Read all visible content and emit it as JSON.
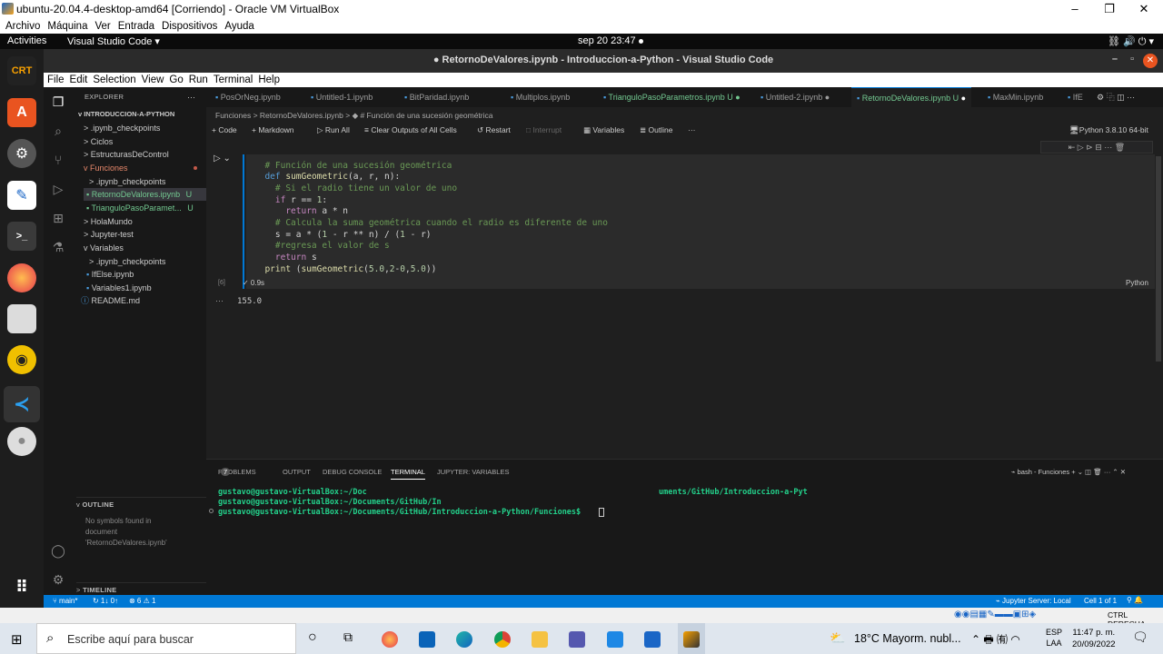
{
  "vbox": {
    "title": "ubuntu-20.04.4-desktop-amd64 [Corriendo] - Oracle VM VirtualBox",
    "menu": [
      "Archivo",
      "Máquina",
      "Ver",
      "Entrada",
      "Dispositivos",
      "Ayuda"
    ],
    "status_host_key": "CTRL DERECHA"
  },
  "ubuntu": {
    "activities": "Activities",
    "app_menu": "Visual Studio Code ▾",
    "clock": "sep 20  23:47"
  },
  "vscode": {
    "title": "● RetornoDeValores.ipynb - Introduccion-a-Python - Visual Studio Code",
    "menu": [
      "File",
      "Edit",
      "Selection",
      "View",
      "Go",
      "Run",
      "Terminal",
      "Help"
    ],
    "explorer_label": "EXPLORER",
    "root": "INTRODUCCION-A-PYTHON",
    "tree": [
      {
        "label": ".ipynb_checkpoints",
        "prefix": ">"
      },
      {
        "label": "Ciclos",
        "prefix": ">"
      },
      {
        "label": "EstructurasDeControl",
        "prefix": ">"
      },
      {
        "label": "Funciones",
        "prefix": "v"
      },
      {
        "label": ".ipynb_checkpoints",
        "prefix": ">"
      },
      {
        "label": "RetornoDeValores.ipynb",
        "badge": "U"
      },
      {
        "label": "TrianguloPasoParamet...",
        "badge": "U"
      },
      {
        "label": "HolaMundo",
        "prefix": ">"
      },
      {
        "label": "Jupyter-test",
        "prefix": ">"
      },
      {
        "label": "Variables",
        "prefix": "v"
      },
      {
        "label": ".ipynb_checkpoints",
        "prefix": ">"
      },
      {
        "label": "IfElse.ipynb"
      },
      {
        "label": "Variables1.ipynb"
      },
      {
        "label": "README.md"
      }
    ],
    "outline_label": "OUTLINE",
    "outline_msg1": "No symbols found in",
    "outline_msg2": "document",
    "outline_msg3": "'RetornoDeValores.ipynb'",
    "timeline_label": "TIMELINE",
    "tabs": [
      "PosOrNeg.ipynb",
      "Untitled-1.ipynb",
      "BitParidad.ipynb",
      "Multiplos.ipynb",
      "TrianguloPasoParametros.ipynb U",
      "Untitled-2.ipynb",
      "RetornoDeValores.ipynb U",
      "MaxMin.ipynb",
      "IfE"
    ],
    "breadcrumb": "Funciones  >  RetornoDeValores.ipynb  >  ◆ # Función de una sucesión geométrica",
    "toolbar": {
      "code": "+ Code",
      "markdown": "+ Markdown",
      "run_all": "▷ Run All",
      "clear": "≡ Clear Outputs of All Cells",
      "restart": "↺ Restart",
      "interrupt": "□ Interrupt",
      "variables": "▦ Variables",
      "outline": "≣ Outline",
      "more": "···",
      "kernel": "Python 3.8.10 64-bit"
    },
    "cell": {
      "exec_count": "[6]",
      "time": "✓  0.9s",
      "language": "Python",
      "output": "155.0",
      "output_marker": "···"
    },
    "panel_tabs": [
      "PROBLEMS",
      "OUTPUT",
      "DEBUG CONSOLE",
      "TERMINAL",
      "JUPYTER: VARIABLES"
    ],
    "problems_count": "7",
    "terminal_name": "bash - Funciones",
    "terminal_lines": [
      "gustavo@gustavo-VirtualBox:~/Doc",
      "gustavo@gustavo-VirtualBox:~/Documents/GitHub/In",
      "gustavo@gustavo-VirtualBox:~/Documents/GitHub/Introduccion-a-Python/Funciones$ "
    ],
    "terminal_overlay": "uments/GitHub/Introduccion-a-Pyt",
    "status": {
      "branch": "main*",
      "sync": "↻ 1↓ 0↑",
      "errors": "⊗ 6 ⚠ 1",
      "jupyter": "Jupyter Server: Local",
      "cell": "Cell 1 of 1"
    }
  },
  "windows": {
    "search_placeholder": "Escribe aquí para buscar",
    "weather": "18°C  Mayorm. nubl...",
    "lang1": "ESP",
    "lang2": "LAA",
    "time": "11:47 p. m.",
    "date": "20/09/2022"
  }
}
